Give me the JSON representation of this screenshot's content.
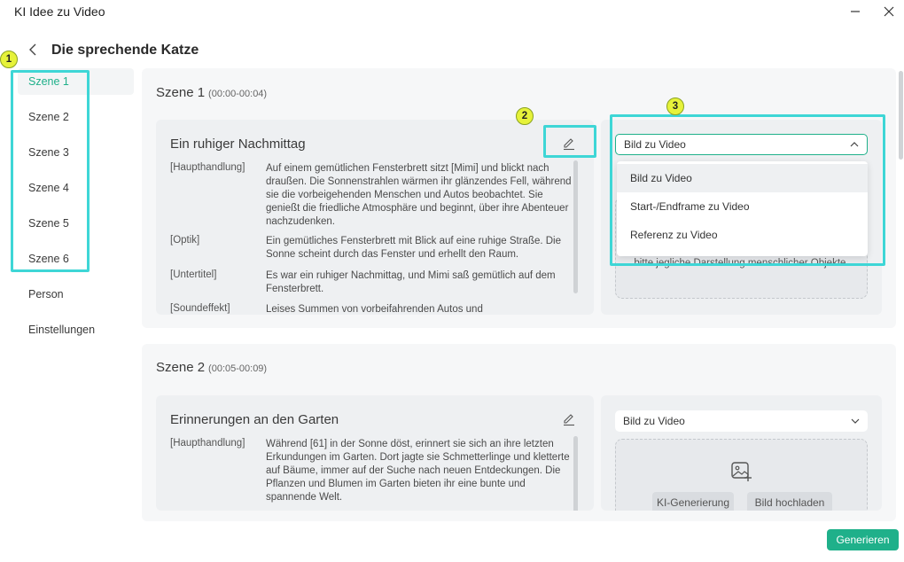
{
  "window": {
    "title": "KI Idee zu Video"
  },
  "header": {
    "title": "Die sprechende Katze"
  },
  "sidebar": {
    "items": [
      {
        "label": "Szene 1"
      },
      {
        "label": "Szene 2"
      },
      {
        "label": "Szene 3"
      },
      {
        "label": "Szene 4"
      },
      {
        "label": "Szene 5"
      },
      {
        "label": "Szene 6"
      },
      {
        "label": "Person"
      },
      {
        "label": "Einstellungen"
      }
    ]
  },
  "scenes": [
    {
      "title": "Szene 1",
      "time": "(00:00-00:04)",
      "card_title": "Ein ruhiger Nachmittag",
      "rows": [
        {
          "key": "[Haupthandlung]",
          "value": "Auf einem gemütlichen Fensterbrett sitzt [Mimi] und blickt nach draußen. Die Sonnenstrahlen wärmen ihr glänzendes Fell, während sie die vorbeigehenden Menschen und Autos beobachtet. Sie genießt die friedliche Atmosphäre und beginnt, über ihre Abenteuer nachzudenken."
        },
        {
          "key": "[Optik]",
          "value": "Ein gemütliches Fensterbrett mit Blick auf eine ruhige Straße. Die Sonne scheint durch das Fenster und erhellt den Raum."
        },
        {
          "key": "[Untertitel]",
          "value": "Es war ein ruhiger Nachmittag, und Mimi saß gemütlich auf dem Fensterbrett."
        },
        {
          "key": "[Soundeffekt]",
          "value": "Leises Summen von vorbeifahrenden Autos und"
        }
      ],
      "mode_select": "Bild zu Video",
      "dropdown_options": [
        "Bild zu Video",
        "Start-/Endframe zu Video",
        "Referenz zu Video"
      ],
      "upload_hint": "bitte jegliche Darstellung menschlicher Objekte."
    },
    {
      "title": "Szene 2",
      "time": "(00:05-00:09)",
      "card_title": "Erinnerungen an den Garten",
      "rows": [
        {
          "key": "[Haupthandlung]",
          "value": "Während [61] in der Sonne döst, erinnert sie sich an ihre letzten Erkundungen im Garten. Dort jagte sie Schmetterlinge und kletterte auf Bäume, immer auf der Suche nach neuen Entdeckungen. Die Pflanzen und Blumen im Garten bieten ihr eine bunte und spannende Welt."
        }
      ],
      "mode_select": "Bild zu Video",
      "ai_button": "KI-Generierung",
      "upload_button": "Bild hochladen"
    }
  ],
  "annotations": [
    "1",
    "2",
    "3"
  ],
  "footer": {
    "generate_label": "Generieren"
  },
  "colors": {
    "accent": "#1fb08a",
    "highlight": "#3ed6d6",
    "badge": "#e6f23a"
  }
}
